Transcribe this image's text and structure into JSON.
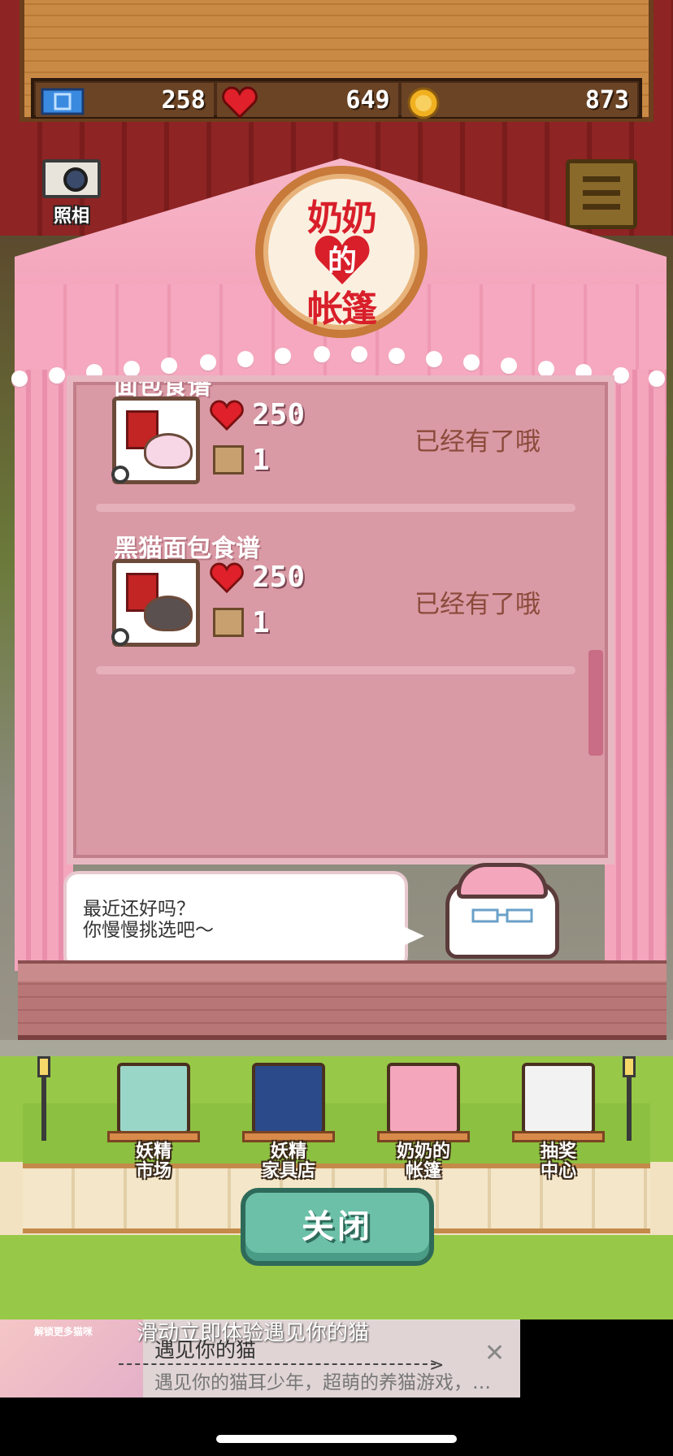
{
  "currencies": [
    {
      "name": "ticket",
      "icon": "ticket-icon",
      "value": "258",
      "color": "#3a8ae0"
    },
    {
      "name": "heart",
      "icon": "heart-icon",
      "value": "649",
      "color": "#e0202a"
    },
    {
      "name": "coin",
      "icon": "coin-icon",
      "value": "873",
      "color": "#f0b020"
    }
  ],
  "camera": {
    "label": "照相"
  },
  "sign": {
    "line1": "奶奶",
    "line2": "的",
    "line3": "帐篷"
  },
  "items": [
    {
      "title": "面包食谱",
      "hearts": "250",
      "boxes": "1",
      "status": "已经有了哦",
      "creature_color": "#f7d6e6"
    },
    {
      "title": "黑猫面包食谱",
      "hearts": "250",
      "boxes": "1",
      "status": "已经有了哦",
      "creature_color": "#5a5050"
    }
  ],
  "bubble": {
    "line1": "最近还好吗？",
    "line2": "你慢慢挑选吧～"
  },
  "shops": [
    {
      "label1": "妖精",
      "label2": "市场",
      "color": "#9ad6c8"
    },
    {
      "label1": "妖精",
      "label2": "家具店",
      "color": "#2a4a8a"
    },
    {
      "label1": "奶奶的",
      "label2": "帐篷",
      "color": "#f4a6bd"
    },
    {
      "label1": "抽奖",
      "label2": "中心",
      "color": "#f2f2f2"
    }
  ],
  "close_button": {
    "label": "关闭"
  },
  "ad": {
    "thumb_text": "解锁更多猫咪",
    "prompt": "滑动立即体验遇见你的猫",
    "title": "遇见你的猫",
    "description": "遇见你的猫耳少年，超萌的养猫游戏，…",
    "close": "✕"
  }
}
